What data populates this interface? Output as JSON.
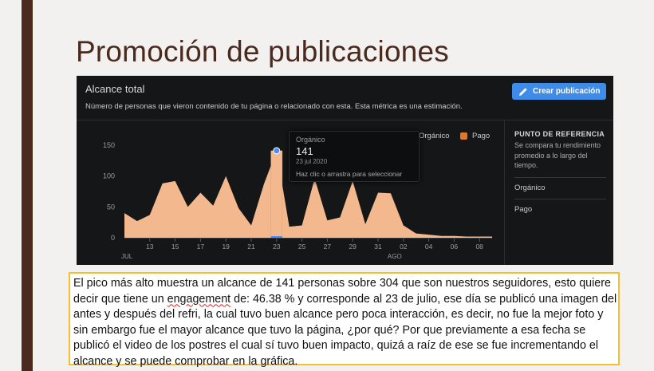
{
  "slide": {
    "title": "Promoción de publicaciones"
  },
  "panel": {
    "title": "Alcance total",
    "subtitle": "Número de personas que vieron contenido de tu página o relacionado con esta. Esta métrica es una estimación.",
    "create_button": "Crear publicación",
    "create_icon": "pencil-icon",
    "legend": [
      {
        "label": "Orgánico",
        "color": "#f3b88d"
      },
      {
        "label": "Pago",
        "color": "#e0772a"
      }
    ],
    "reference": {
      "title": "PUNTO DE REFERENCIA",
      "description": "Se compara tu rendimiento promedio a lo largo del tiempo.",
      "items": [
        "Orgánico",
        "Pago"
      ]
    },
    "tooltip": {
      "label": "Orgánico",
      "value": "141",
      "date": "23 jul 2020",
      "hint": "Haz clic o arrastra para seleccionar"
    }
  },
  "chart_data": {
    "type": "area",
    "series": [
      {
        "name": "Orgánico",
        "values": [
          40,
          27,
          37,
          88,
          92,
          50,
          73,
          52,
          100,
          48,
          20,
          87,
          141,
          18,
          20,
          96,
          28,
          33,
          92,
          22,
          73,
          72,
          20,
          7,
          5,
          3,
          3,
          2,
          2,
          2
        ]
      },
      {
        "name": "Pago",
        "values": [
          0,
          0,
          0,
          0,
          0,
          0,
          0,
          0,
          0,
          0,
          0,
          0,
          2,
          0,
          0,
          0,
          0,
          0,
          0,
          0,
          0,
          0,
          0,
          0,
          0,
          0,
          0,
          0,
          0,
          0
        ]
      }
    ],
    "x": [
      "11",
      "12",
      "13",
      "14",
      "15",
      "16",
      "17",
      "18",
      "19",
      "20",
      "21",
      "22",
      "23",
      "24",
      "25",
      "26",
      "27",
      "28",
      "29",
      "30",
      "31",
      "01",
      "02",
      "03",
      "04",
      "05",
      "06",
      "07",
      "08",
      "09"
    ],
    "tick_labels": [
      "13",
      "15",
      "17",
      "19",
      "21",
      "23",
      "25",
      "27",
      "29",
      "31",
      "02",
      "04",
      "06",
      "08"
    ],
    "tick_indices": [
      2,
      4,
      6,
      8,
      10,
      12,
      14,
      16,
      18,
      20,
      22,
      24,
      26,
      28
    ],
    "month_labels": [
      {
        "label": "JUL",
        "index": 0
      },
      {
        "label": "AGO",
        "index": 21
      }
    ],
    "y_ticks": [
      0,
      50,
      100,
      150
    ],
    "ylim": [
      0,
      160
    ],
    "highlight_index": 12,
    "colors": {
      "organic": "#f3b88d",
      "paid": "#e0772a",
      "highlight": "#4a8dff",
      "tick": "#9a9da1"
    }
  },
  "caption": {
    "text_before": "El pico más alto muestra un alcance de 141 personas sobre 304 que son nuestros seguidores, esto quiere decir que tiene un ",
    "underlined": "engagement",
    "text_after": " de: 46.38 % y corresponde al 23 de julio, ese día se publicó una imagen del antes y después del refri, la cual tuvo buen alcance pero poca interacción, es decir, no fue la mejor foto y sin embargo fue el mayor alcance que tuvo la página, ¿por qué? Por que previamente a esa fecha se publicó el video de los postres el cual sí tuvo buen impacto, quizá a raíz de ese se fue incrementando el alcance y se puede comprobar en la gráfica."
  }
}
